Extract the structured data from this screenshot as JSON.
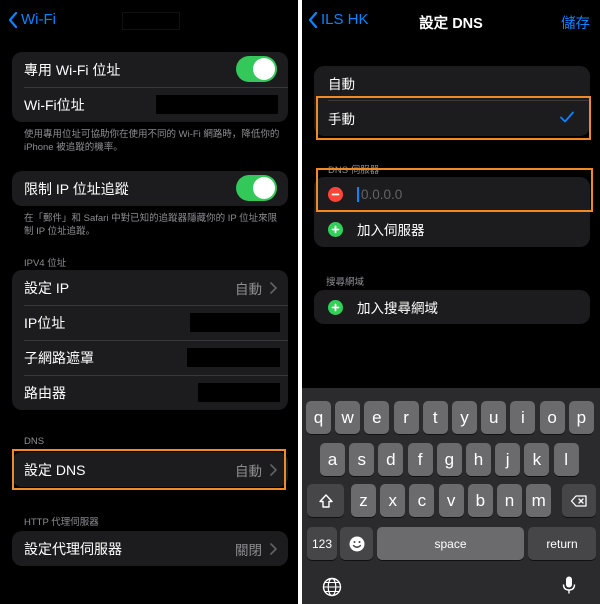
{
  "left_screen": {
    "nav": {
      "back_label": "Wi-Fi"
    },
    "private_address": {
      "label": "專用 Wi-Fi 位址",
      "enabled": true
    },
    "wifi_address": {
      "label": "Wi-Fi位址"
    },
    "private_footer": "使用專用位址可協助你在使用不同的 Wi-Fi 網路時，降低你的iPhone 被追蹤的機率。",
    "limit_tracking": {
      "label": "限制 IP 位址追蹤",
      "enabled": true
    },
    "limit_footer": "在「郵件」和 Safari 中對已知的追蹤器隱藏你的 IP 位址來限制 IP 位址追蹤。",
    "ipv4": {
      "header": "IPV4 位址",
      "configure_ip_label": "設定 IP",
      "configure_ip_value": "自動",
      "ip_label": "IP位址",
      "subnet_label": "子網路遮罩",
      "router_label": "路由器"
    },
    "dns": {
      "header": "DNS",
      "label": "設定 DNS",
      "value": "自動"
    },
    "http_proxy": {
      "header": "HTTP 代理伺服器",
      "label": "設定代理伺服器",
      "value": "關閉"
    }
  },
  "right_screen": {
    "nav": {
      "back_label": "ILS HK",
      "title": "設定 DNS",
      "save_label": "儲存"
    },
    "mode": {
      "automatic_label": "自動",
      "manual_label": "手動",
      "selected": "手動"
    },
    "servers": {
      "header": "DNS 伺服器",
      "input_placeholder": "0.0.0.0",
      "add_label": "加入伺服器"
    },
    "search_domains": {
      "header": "搜尋網域",
      "add_label": "加入搜尋網域"
    },
    "keyboard": {
      "row1": [
        "q",
        "w",
        "e",
        "r",
        "t",
        "y",
        "u",
        "i",
        "o",
        "p"
      ],
      "row2": [
        "a",
        "s",
        "d",
        "f",
        "g",
        "h",
        "j",
        "k",
        "l"
      ],
      "row3": [
        "z",
        "x",
        "c",
        "v",
        "b",
        "n",
        "m"
      ],
      "numbers_label": "123",
      "space_label": "space",
      "return_label": "return"
    }
  },
  "colors": {
    "accent_blue": "#0a84ff",
    "toggle_green": "#34c759",
    "highlight_orange": "#f08a24",
    "delete_red": "#ff453a",
    "add_green": "#30d158"
  }
}
